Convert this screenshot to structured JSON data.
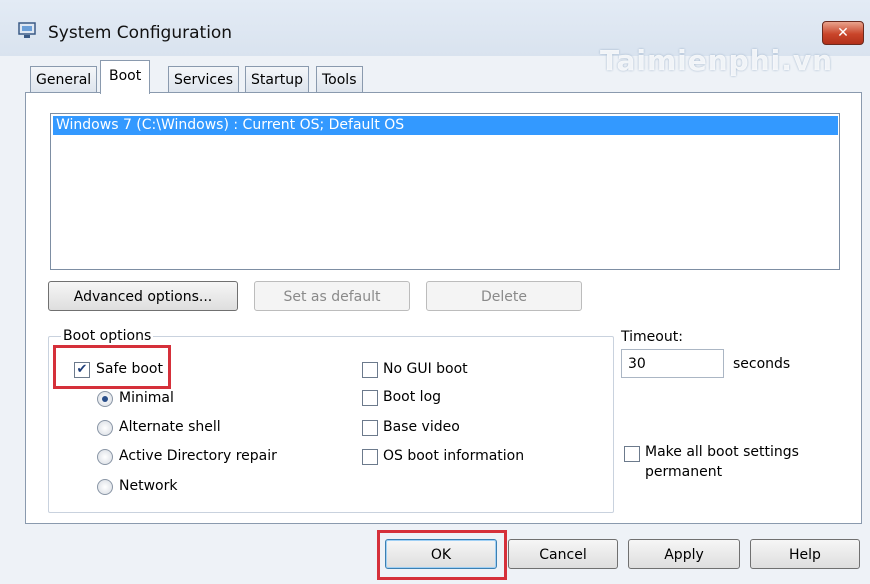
{
  "window": {
    "title": "System Configuration",
    "watermark": "Taimienphi.vn",
    "close_glyph": "✕"
  },
  "tabs": [
    {
      "label": "General"
    },
    {
      "label": "Boot"
    },
    {
      "label": "Services"
    },
    {
      "label": "Startup"
    },
    {
      "label": "Tools"
    }
  ],
  "os_list": {
    "items": [
      "Windows 7 (C:\\Windows) : Current OS; Default OS"
    ],
    "selected": 0
  },
  "buttons": {
    "advanced": "Advanced options...",
    "set_default": "Set as default",
    "delete": "Delete"
  },
  "boot_options": {
    "label": "Boot options",
    "safe_boot": {
      "label": "Safe boot",
      "checked": true
    },
    "radios": [
      {
        "label": "Minimal",
        "selected": true
      },
      {
        "label": "Alternate shell",
        "selected": false
      },
      {
        "label": "Active Directory repair",
        "selected": false
      },
      {
        "label": "Network",
        "selected": false
      }
    ],
    "checks": [
      {
        "label": "No GUI boot",
        "checked": false
      },
      {
        "label": "Boot log",
        "checked": false
      },
      {
        "label": "Base video",
        "checked": false
      },
      {
        "label": "OS boot information",
        "checked": false
      }
    ]
  },
  "timeout": {
    "label": "Timeout:",
    "value": "30",
    "unit": "seconds"
  },
  "permanent": {
    "label_line1": "Make all boot settings",
    "label_line2": "permanent",
    "checked": false
  },
  "footer": {
    "ok": "OK",
    "cancel": "Cancel",
    "apply": "Apply",
    "help": "Help"
  },
  "colors": {
    "selection": "#3399ff",
    "highlight": "#d5303a"
  }
}
